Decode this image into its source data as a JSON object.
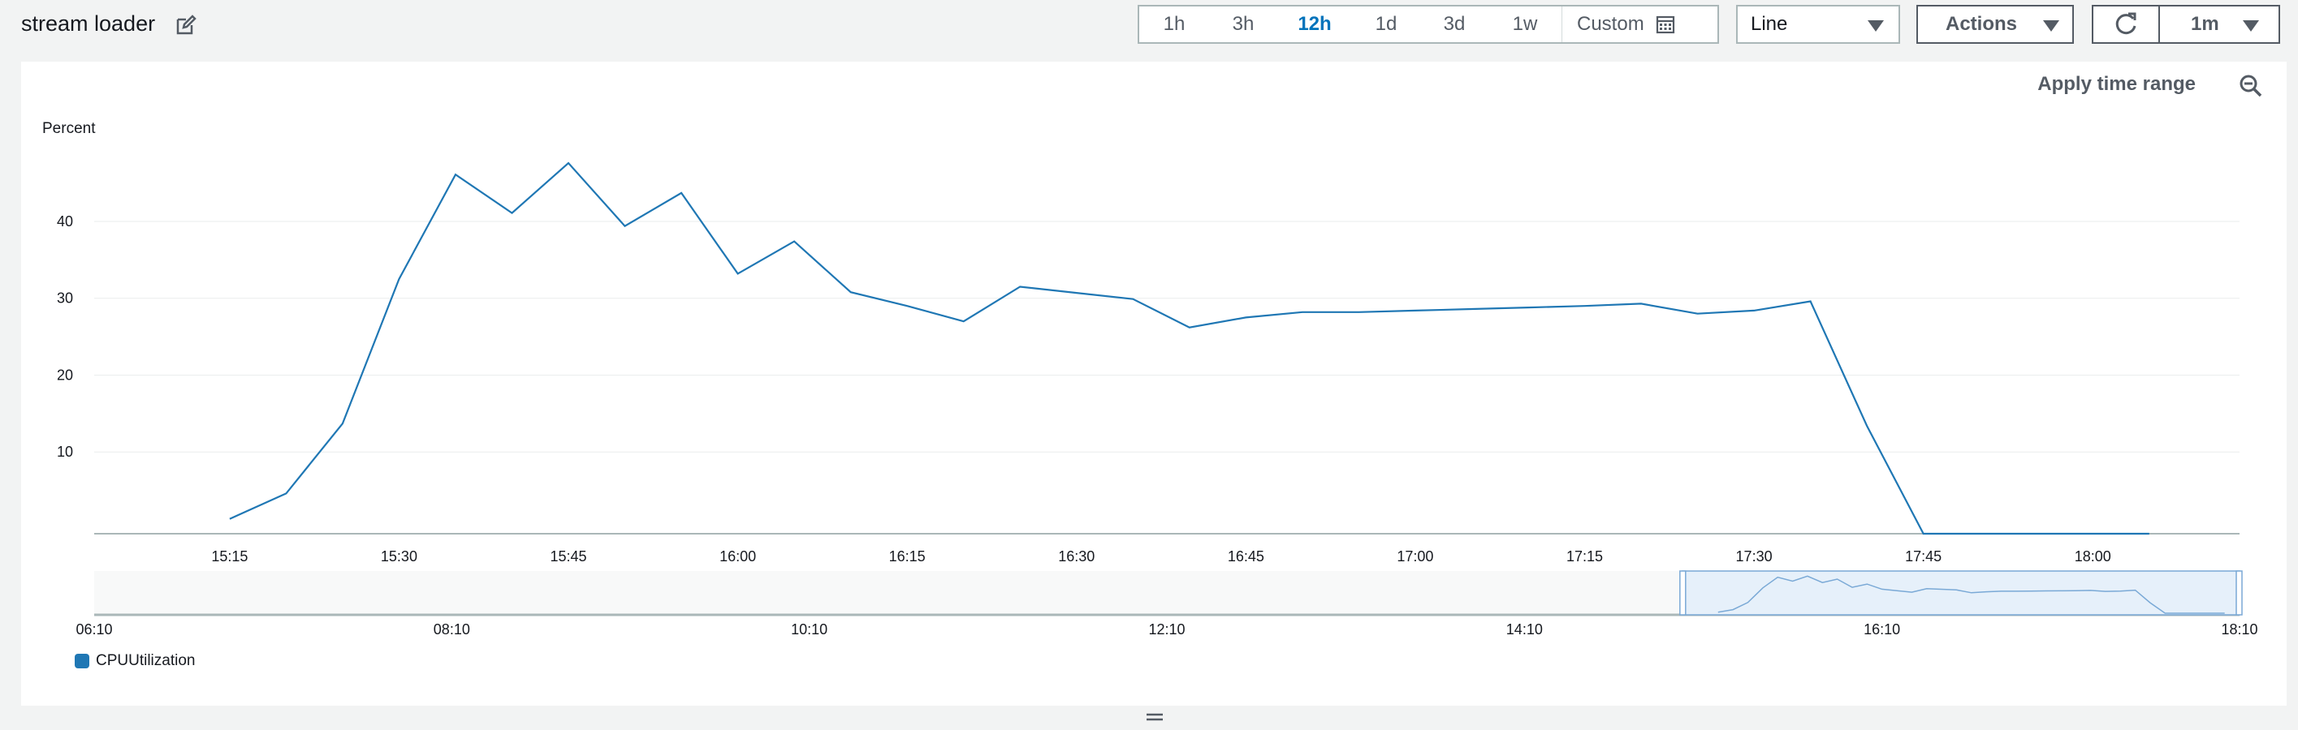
{
  "widget": {
    "title": "stream loader"
  },
  "time_ranges": {
    "options": [
      "1h",
      "3h",
      "12h",
      "1d",
      "3d",
      "1w"
    ],
    "active": "12h",
    "custom_label": "Custom"
  },
  "chart_type_select": {
    "value": "Line"
  },
  "actions_button": {
    "label": "Actions"
  },
  "refresh_interval": {
    "value": "1m"
  },
  "panel": {
    "apply_time_range": "Apply time range"
  },
  "chart_data": {
    "type": "line",
    "ylabel": "Percent",
    "yticks": [
      "10",
      "20",
      "30",
      "40"
    ],
    "ylim": [
      0,
      50
    ],
    "xticks": [
      "15:15",
      "15:30",
      "15:45",
      "16:00",
      "16:15",
      "16:30",
      "16:45",
      "17:00",
      "17:15",
      "17:30",
      "17:45",
      "18:00"
    ],
    "series": [
      {
        "name": "CPUUtilization",
        "color": "#1f77b4",
        "x": [
          "15:15",
          "15:20",
          "15:25",
          "15:30",
          "15:35",
          "15:40",
          "15:45",
          "15:50",
          "15:55",
          "16:00",
          "16:05",
          "16:10",
          "16:15",
          "16:20",
          "16:25",
          "16:30",
          "16:35",
          "16:40",
          "16:45",
          "16:50",
          "16:55",
          "17:00",
          "17:05",
          "17:10",
          "17:15",
          "17:20",
          "17:25",
          "17:30",
          "17:35",
          "17:40",
          "17:45",
          "17:50",
          "17:55",
          "18:00",
          "18:05"
        ],
        "values": [
          1.3,
          4.6,
          13.7,
          32.5,
          46.1,
          41.1,
          47.6,
          39.4,
          43.7,
          33.2,
          37.4,
          30.8,
          29.0,
          27.0,
          31.5,
          30.7,
          29.9,
          26.2,
          27.5,
          28.2,
          28.2,
          28.4,
          28.6,
          28.8,
          29.0,
          29.3,
          28.0,
          28.4,
          29.6,
          13.4,
          0.0,
          0.0,
          0.0,
          0.0,
          0.0
        ]
      }
    ],
    "navigator": {
      "xticks": [
        "06:10",
        "08:10",
        "10:10",
        "12:10",
        "14:10",
        "16:10",
        "18:10"
      ]
    },
    "legend": [
      "CPUUtilization"
    ]
  }
}
